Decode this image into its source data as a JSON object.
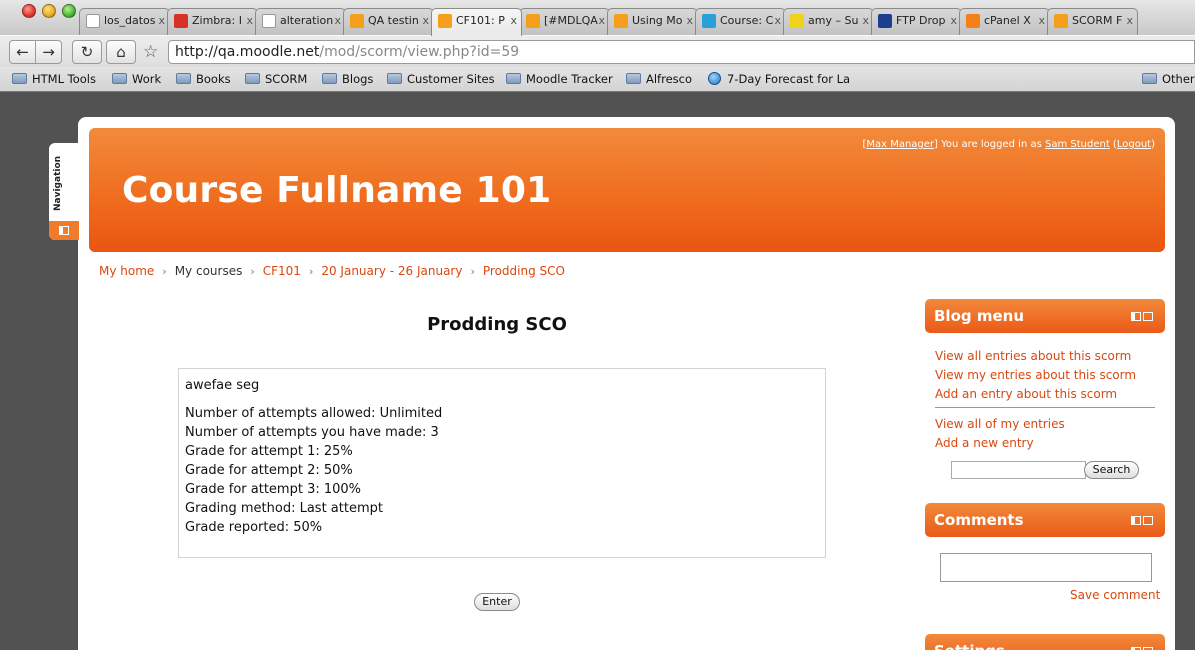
{
  "browser": {
    "tabs": [
      {
        "label": "los_datos",
        "fav": "doc",
        "color": "#ffffff"
      },
      {
        "label": "Zimbra: I",
        "fav": "zimbra",
        "color": "#d6322a"
      },
      {
        "label": "alteration",
        "fav": "google",
        "color": "#ffffff"
      },
      {
        "label": "QA testin",
        "fav": "moodle",
        "color": "#f59f1c"
      },
      {
        "label": "CF101: P",
        "fav": "moodle",
        "color": "#f59f1c",
        "active": true
      },
      {
        "label": "[#MDLQA",
        "fav": "moodle-m",
        "color": "#f59f1c"
      },
      {
        "label": "Using Mo",
        "fav": "moodle",
        "color": "#f59f1c"
      },
      {
        "label": "Course: C",
        "fav": "course",
        "color": "#2aa0d8"
      },
      {
        "label": "amy – Su",
        "fav": "amy",
        "color": "#f1d21b"
      },
      {
        "label": "FTP Drop",
        "fav": "ftp",
        "color": "#1d3e8c"
      },
      {
        "label": "cPanel X",
        "fav": "cpanel",
        "color": "#f57f17"
      },
      {
        "label": "SCORM F",
        "fav": "moodle",
        "color": "#f59f1c"
      }
    ],
    "tab_close": "x",
    "url_host": "http://qa.moodle.net",
    "url_path": "/mod/scorm/view.php?id=59",
    "bookmarks": [
      {
        "label": "HTML Tools",
        "type": "folder"
      },
      {
        "label": "Work",
        "type": "folder"
      },
      {
        "label": "Books",
        "type": "folder"
      },
      {
        "label": "SCORM",
        "type": "folder"
      },
      {
        "label": "Blogs",
        "type": "folder"
      },
      {
        "label": "Customer Sites",
        "type": "folder"
      },
      {
        "label": "Moodle Tracker",
        "type": "folder"
      },
      {
        "label": "Alfresco",
        "type": "folder"
      },
      {
        "label": "7-Day Forecast for La",
        "type": "link"
      },
      {
        "label": "Other",
        "type": "folder"
      }
    ]
  },
  "nav": {
    "label": "Navigation"
  },
  "header": {
    "login_prefix": "[",
    "manager_link": "Max Manager",
    "login_text": "] You are logged in as ",
    "user_link": "Sam Student",
    "logout_open": " (",
    "logout_link": "Logout",
    "logout_close": ")",
    "course_title": "Course Fullname 101"
  },
  "breadcrumb": [
    {
      "label": "My home",
      "link": true
    },
    {
      "label": "My courses",
      "link": false
    },
    {
      "label": "CF101",
      "link": true
    },
    {
      "label": "20 January - 26 January",
      "link": true
    },
    {
      "label": "Prodding SCO",
      "link": true
    }
  ],
  "breadcrumb_sep": "›",
  "main": {
    "title": "Prodding SCO",
    "intro": "awefae seg",
    "lines": [
      "Number of attempts allowed: Unlimited",
      "Number of attempts you have made: 3",
      "Grade for attempt 1: 25%",
      "Grade for attempt 2: 50%",
      "Grade for attempt 3: 100%",
      "Grading method: Last attempt",
      "Grade reported: 50%"
    ],
    "enter_label": "Enter"
  },
  "blocks": {
    "blog_menu": {
      "title": "Blog menu",
      "links": [
        "View all entries about this scorm",
        "View my entries about this scorm",
        "Add an entry about this scorm"
      ],
      "links2": [
        "View all of my entries",
        "Add a new entry"
      ],
      "search_label": "Search"
    },
    "comments": {
      "title": "Comments",
      "save_label": "Save comment"
    },
    "settings": {
      "title": "Settings"
    }
  }
}
